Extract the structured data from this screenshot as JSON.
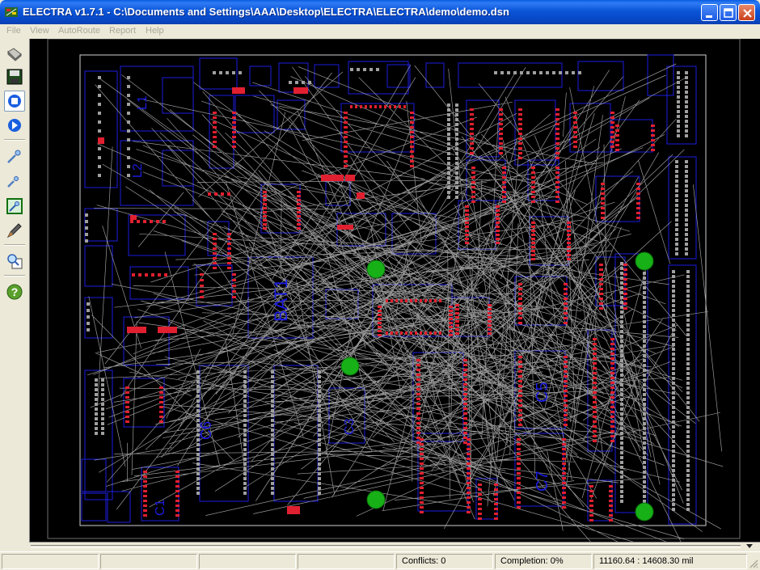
{
  "window": {
    "title": "ELECTRA v1.7.1 - C:\\Documents and Settings\\AAA\\Desktop\\ELECTRA\\ELECTRA\\demo\\demo.dsn"
  },
  "menu": [
    "File",
    "View",
    "AutoRoute",
    "Report",
    "Help"
  ],
  "toolbar": {
    "tools": [
      "open-folder-icon",
      "save-disk-icon",
      "stop-icon",
      "play-icon",
      "zoom-in-icon",
      "zoom-out-icon",
      "zoom-fit-icon",
      "pen-icon",
      "inspect-icon",
      "help-icon"
    ]
  },
  "board": {
    "labels": [
      "L1",
      "L2",
      "BAT1",
      "C7",
      "C5",
      "C6",
      "C3",
      "C1"
    ]
  },
  "status": {
    "conflicts": "Conflicts: 0",
    "completion": "Completion: 0%",
    "coords": "11160.64 : 14608.30 mil"
  },
  "colors": {
    "board_bg": "#000000",
    "outline": "#1c1ce0",
    "pad": "#e02030",
    "pad_gray": "#a0a0a0",
    "ratsnest": "#b4b4b4",
    "marker": "#17b017"
  }
}
